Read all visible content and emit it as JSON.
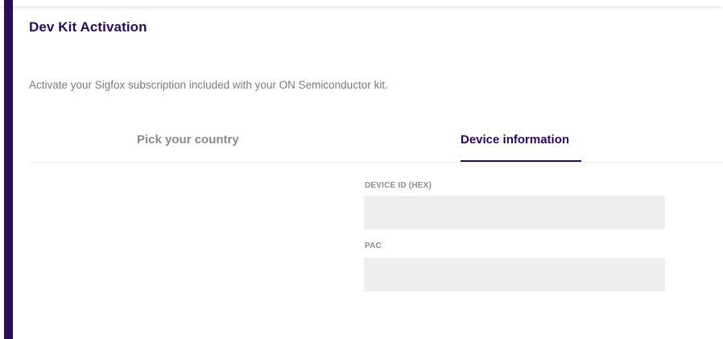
{
  "header": {
    "title": "Dev Kit Activation",
    "subtitle": "Activate your Sigfox subscription included with your ON Semiconductor kit."
  },
  "tabs": [
    {
      "label": "Pick your country",
      "active": false
    },
    {
      "label": "Device information",
      "active": true
    }
  ],
  "form": {
    "device_id": {
      "label": "DEVICE ID (HEX)",
      "value": "",
      "placeholder": ""
    },
    "pac": {
      "label": "PAC",
      "value": "",
      "placeholder": ""
    }
  },
  "colors": {
    "accent": "#2b0a5e",
    "inactive_tab": "#8a8a8a",
    "input_bg": "#eeeeee",
    "muted_text": "#7a7a7a"
  }
}
